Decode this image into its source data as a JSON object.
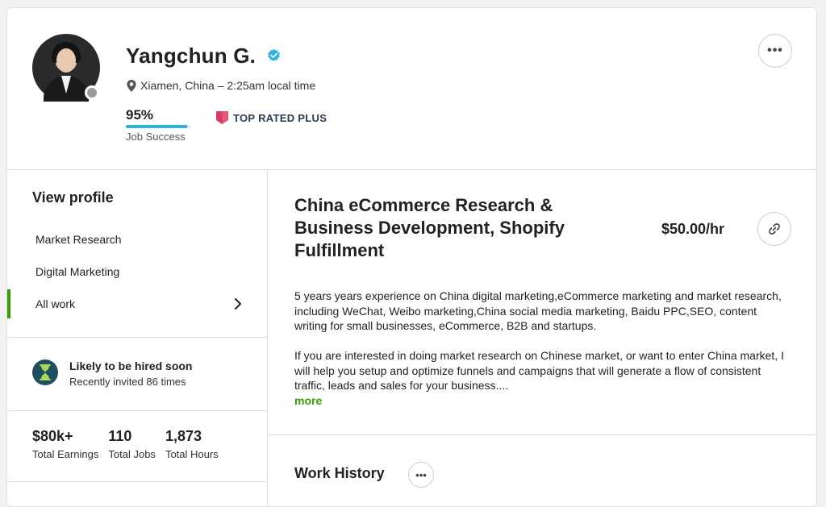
{
  "profile": {
    "name": "Yangchun G.",
    "location": "Xiamen, China",
    "local_time": " – 2:25am local time",
    "job_success_value": "95%",
    "job_success_fraction": 0.95,
    "job_success_label": "Job Success",
    "badge": "TOP RATED PLUS",
    "more_icon": "ellipsis-icon",
    "colors": {
      "accent": "#37a000",
      "jss_bar": "#2fb2e2",
      "badge": "#e8577a",
      "verified": "#2fb2e2"
    }
  },
  "sidebar": {
    "title": "View profile",
    "items": [
      {
        "label": "Market Research"
      },
      {
        "label": "Digital Marketing"
      },
      {
        "label": "All work"
      }
    ],
    "hire_title": "Likely to be hired soon",
    "hire_sub": "Recently invited 86 times",
    "stats": [
      {
        "value": "$80k+",
        "label": "Total Earnings"
      },
      {
        "value": "110",
        "label": "Total Jobs"
      },
      {
        "value": "1,873",
        "label": "Total Hours"
      }
    ]
  },
  "main": {
    "title": "China eCommerce Research & Business Development, Shopify Fulfillment",
    "rate": "$50.00/hr",
    "desc_p1": "5 years years experience on China digital marketing,eCommerce marketing and market research, including WeChat, Weibo marketing,China social media marketing, Baidu PPC,SEO, content writing for small businesses, eCommerce, B2B and startups.",
    "desc_p2": "If you are interested in doing market research on Chinese market, or want to enter China market, I will help you setup and optimize funnels and campaigns that will generate a flow of consistent traffic, leads and sales for your business....",
    "more": "more",
    "work_history": "Work History"
  }
}
